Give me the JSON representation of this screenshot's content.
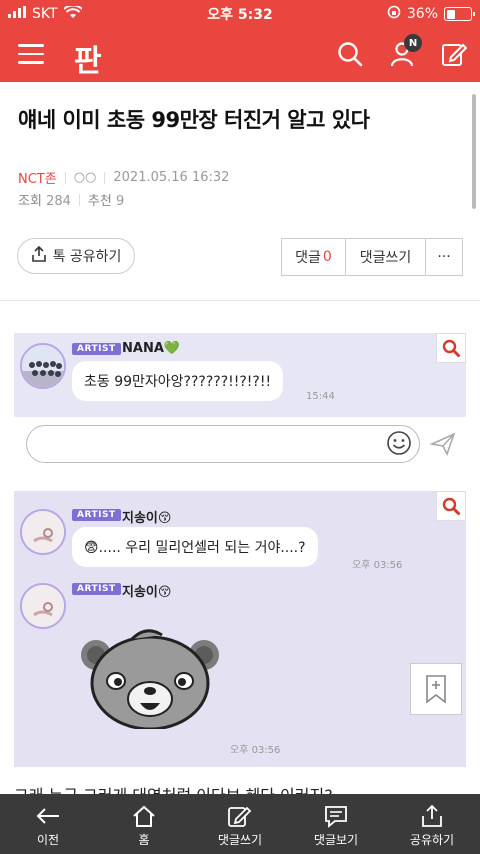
{
  "status_bar": {
    "carrier": "SKT",
    "time": "오후 5:32",
    "battery": "36%",
    "battery_level": 0.36
  },
  "header": {
    "logo_text": "판",
    "notification_badge": "N"
  },
  "post": {
    "title": "얘네 이미 초동 99만장 터진거 알고 있다",
    "category": "NCT존",
    "author": "○○",
    "date": "2021.05.16 16:32",
    "views_label": "조회",
    "views": "284",
    "likes_label": "추천",
    "likes": "9"
  },
  "actions": {
    "share_label": "톡 공유하기",
    "comments_label": "댓글",
    "comments_count": "0",
    "write_comment_label": "댓글쓰기",
    "more_label": "···"
  },
  "chat1": {
    "badge": "ARTIST",
    "name": "NANA💚",
    "message": "초동 99만자아앙??????!!?!?!!",
    "time": "15:44"
  },
  "chat2": {
    "badge": "ARTIST",
    "name": "지송이😚",
    "message": "😨..... 우리 밀리언셀러 되는 거야....?",
    "time": "오후 03:56",
    "badge2": "ARTIST",
    "name2": "지송이😚",
    "sticker_time": "오후 03:56"
  },
  "body_text": "그래 누구 그러게 대역처럼 이다보 헤다 이러지?",
  "bottom_nav": [
    {
      "label": "이전",
      "icon": "back-arrow-icon"
    },
    {
      "label": "홈",
      "icon": "home-icon"
    },
    {
      "label": "댓글쓰기",
      "icon": "write-comment-icon"
    },
    {
      "label": "댓글보기",
      "icon": "view-comments-icon"
    },
    {
      "label": "공유하기",
      "icon": "share-icon"
    }
  ],
  "colors": {
    "brand": "#e9463f",
    "chat_bg": "#e7e6f5",
    "artist_badge": "#7d6fd4",
    "bottom_bar": "#3a3a3a"
  }
}
